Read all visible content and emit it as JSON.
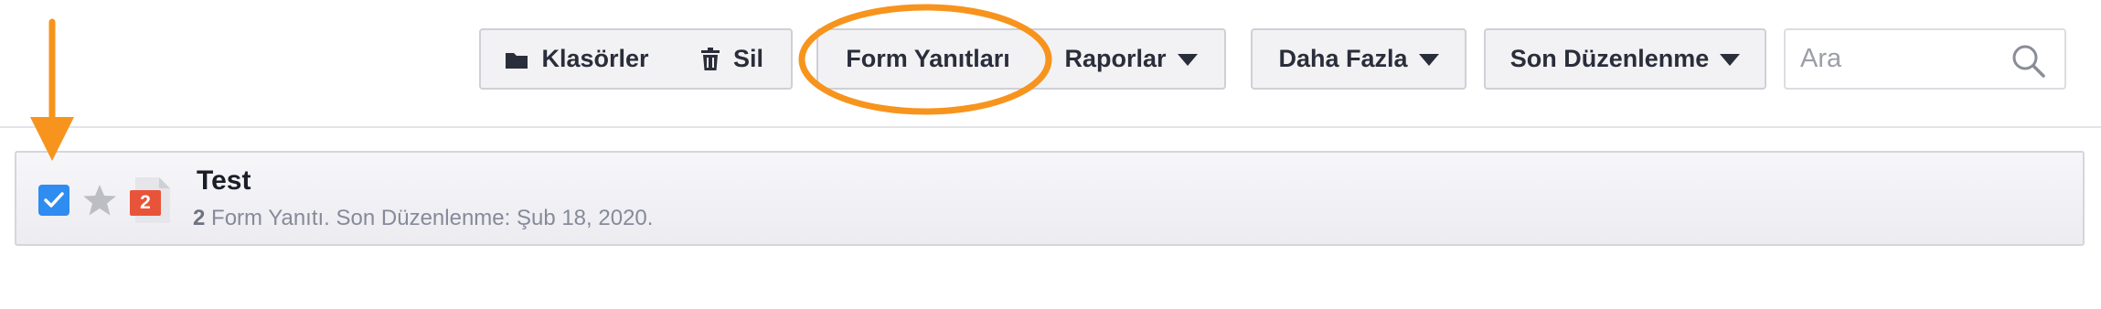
{
  "toolbar": {
    "folders_label": "Klasörler",
    "delete_label": "Sil",
    "form_responses_label": "Form Yanıtları",
    "reports_label": "Raporlar",
    "more_label": "Daha Fazla",
    "sort_label": "Son Düzenlenme"
  },
  "search": {
    "placeholder": "Ara",
    "value": ""
  },
  "forms": [
    {
      "title": "Test",
      "response_count": "2",
      "meta_text": " Form Yanıtı. Son Düzenlenme: Şub 18, 2020.",
      "badge": "2",
      "checked": true,
      "starred": false
    }
  ],
  "icons": {
    "folders": "folder-icon",
    "delete": "trash-icon",
    "reports_caret": "caret-down-icon",
    "more_caret": "caret-down-icon",
    "sort_caret": "caret-down-icon",
    "search": "search-icon",
    "checkbox": "checkmark-icon",
    "star": "star-icon",
    "form": "form-document-icon"
  },
  "colors": {
    "accent_blue": "#2f8cf0",
    "badge_red": "#e8543a",
    "annotation_orange": "#f7941d"
  }
}
